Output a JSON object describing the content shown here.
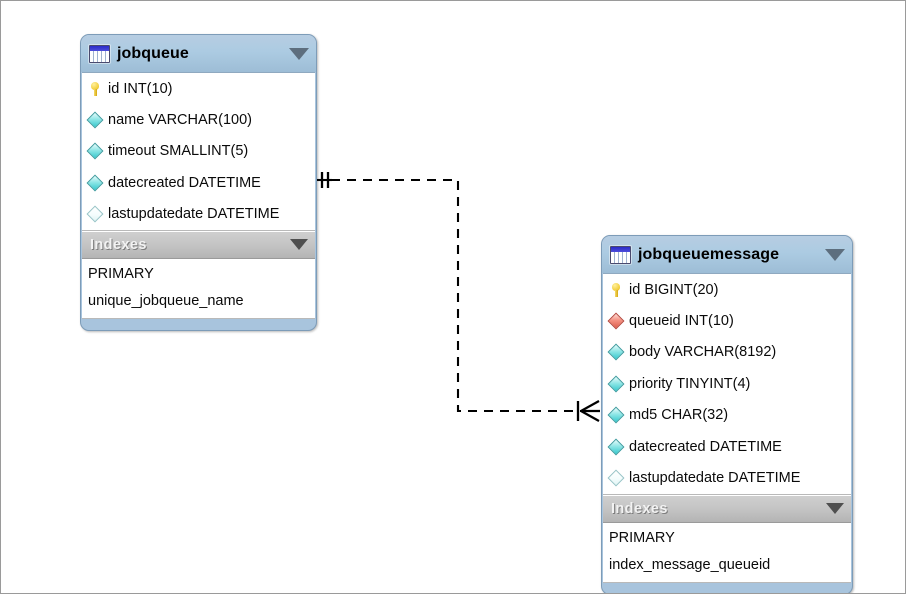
{
  "diagram": {
    "title": "Database ER diagram",
    "background": "#ffffff",
    "entity_header_color": "#accbe2",
    "index_header_color": "#c4c4c4",
    "pk_icon_color": "#f2cf3e",
    "column_icon_color": "#35c9cd",
    "fk_icon_color": "#de5d4c",
    "line_color": "#000000"
  },
  "entities": [
    {
      "name": "jobqueue",
      "icon": "table-icon",
      "collapse_icon": "chevron-down-icon",
      "columns": [
        {
          "label": "id INT(10)",
          "icon": "primary-key-icon"
        },
        {
          "label": "name VARCHAR(100)",
          "icon": "column-icon"
        },
        {
          "label": "timeout SMALLINT(5)",
          "icon": "column-icon"
        },
        {
          "label": "datecreated DATETIME",
          "icon": "column-icon"
        },
        {
          "label": "lastupdatedate DATETIME",
          "icon": "column-nullable-icon"
        }
      ],
      "indexes_label": "Indexes",
      "indexes": [
        {
          "label": "PRIMARY"
        },
        {
          "label": "unique_jobqueue_name"
        }
      ]
    },
    {
      "name": "jobqueuemessage",
      "icon": "table-icon",
      "collapse_icon": "chevron-down-icon",
      "columns": [
        {
          "label": "id BIGINT(20)",
          "icon": "primary-key-icon"
        },
        {
          "label": "queueid INT(10)",
          "icon": "foreign-key-icon"
        },
        {
          "label": "body VARCHAR(8192)",
          "icon": "column-icon"
        },
        {
          "label": "priority TINYINT(4)",
          "icon": "column-icon"
        },
        {
          "label": "md5 CHAR(32)",
          "icon": "column-icon"
        },
        {
          "label": "datecreated DATETIME",
          "icon": "column-icon"
        },
        {
          "label": "lastupdatedate DATETIME",
          "icon": "column-nullable-icon"
        }
      ],
      "indexes_label": "Indexes",
      "indexes": [
        {
          "label": "PRIMARY"
        },
        {
          "label": "index_message_queueid"
        }
      ]
    }
  ],
  "relationship": {
    "from_entity": "jobqueue",
    "from_column": "datecreated",
    "to_entity": "jobqueuemessage",
    "to_column": "md5",
    "from_cardinality": "one",
    "to_cardinality": "many",
    "style": "dashed"
  }
}
